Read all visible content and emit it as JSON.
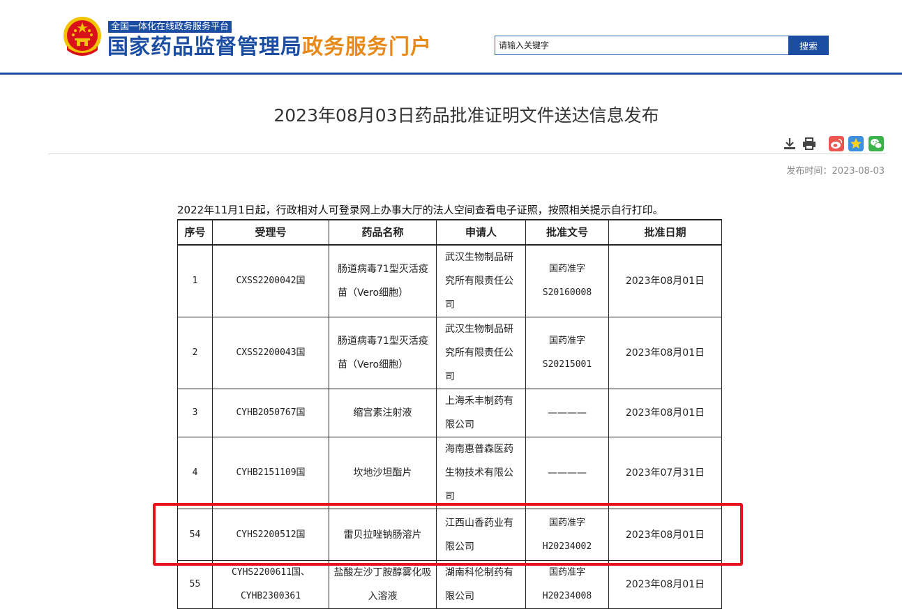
{
  "header": {
    "platform_tag": "全国一体化在线政务服务平台",
    "title_part1": "国家药品监督管理局",
    "title_part2": "政务服务门户",
    "search_placeholder": "请输入关键字",
    "search_button": "搜索",
    "colors": {
      "brand_blue": "#1b4ea2",
      "accent_orange": "#e88a1a"
    }
  },
  "article": {
    "title": "2023年08月03日药品批准证明文件送达信息发布",
    "publish_label": "发布时间：",
    "publish_date": "2023-08-03",
    "intro": "2022年11月1日起，行政相对人可登录网上办事大厅的法人空间查看电子证照，按照相关提示自行打印。",
    "tools": [
      "download-icon",
      "print-icon",
      "weibo-icon",
      "favorite-icon",
      "wechat-icon"
    ]
  },
  "table": {
    "headers": [
      "序号",
      "受理号",
      "药品名称",
      "申请人",
      "批准文号",
      "批准日期"
    ],
    "rows": [
      {
        "no": "1",
        "accept": "CXSS2200042国",
        "drug": "肠道病毒71型灭活疫苗（Vero细胞）",
        "applicant": "武汉生物制品研究所有限责任公司",
        "approval": "国药准字S20160008",
        "date": "2023年08月01日"
      },
      {
        "no": "2",
        "accept": "CXSS2200043国",
        "drug": "肠道病毒71型灭活疫苗（Vero细胞）",
        "applicant": "武汉生物制品研究所有限责任公司",
        "approval": "国药准字S20215001",
        "date": "2023年08月01日"
      },
      {
        "no": "3",
        "accept": "CYHB2050767国",
        "drug": "缩宫素注射液",
        "applicant": "上海禾丰制药有限公司",
        "approval": "————",
        "date": "2023年08月01日"
      },
      {
        "no": "4",
        "accept": "CYHB2151109国",
        "drug": "坎地沙坦酯片",
        "applicant": "海南惠普森医药生物技术有限公司",
        "approval": "————",
        "date": "2023年07月31日"
      },
      {
        "no": "54",
        "accept": "CYHS2200512国",
        "drug": "雷贝拉唑钠肠溶片",
        "applicant": "江西山香药业有限公司",
        "approval": "国药准字H20234002",
        "date": "2023年08月01日"
      },
      {
        "no": "55",
        "accept": "CYHS2200611国、CYHB2300361",
        "drug": "盐酸左沙丁胺醇雾化吸入溶液",
        "applicant": "湖南科伦制药有限公司",
        "approval": "国药准字H20234008",
        "date": "2023年08月01日"
      }
    ],
    "highlight_color": "#e8141b"
  }
}
